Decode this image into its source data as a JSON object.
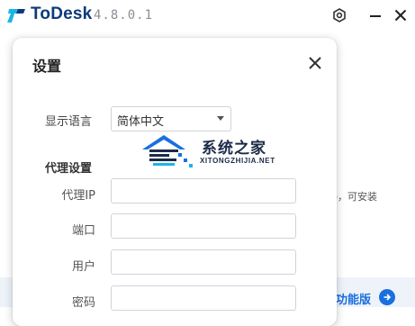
{
  "app": {
    "name": "ToDesk",
    "version": "4.8.0.1"
  },
  "background": {
    "hint_text": "码，可安装",
    "feature_link": "功能版"
  },
  "dialog": {
    "title": "设置",
    "language": {
      "label": "显示语言",
      "selected": "简体中文"
    },
    "proxy": {
      "section_title": "代理设置",
      "fields": {
        "ip_label": "代理IP",
        "ip_value": "",
        "port_label": "端口",
        "port_value": "",
        "user_label": "用户",
        "user_value": "",
        "password_label": "密码",
        "password_value": ""
      }
    }
  },
  "watermark": {
    "text": "系统之家",
    "subtext": "XITONGZHIJIA.NET"
  },
  "colors": {
    "brand_dark": "#0d3a7a",
    "accent": "#1a6fe0",
    "logo_cyan": "#19b6e8"
  }
}
